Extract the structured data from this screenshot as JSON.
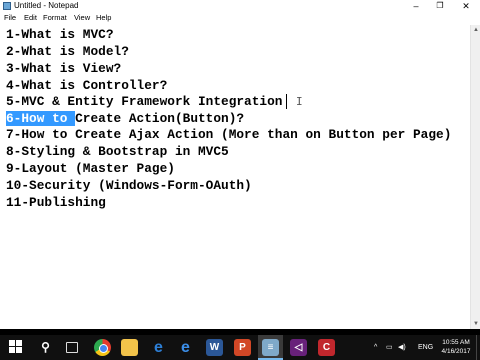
{
  "window": {
    "title": "Untitled - Notepad",
    "controls": {
      "minimize": "–",
      "maximize": "❐",
      "close": "✕"
    }
  },
  "menu": [
    "File",
    "Edit",
    "Format",
    "View",
    "Help"
  ],
  "editor": {
    "lines": [
      "1-What is MVC?",
      "2-What is Model?",
      "3-What is View?",
      "4-What is Controller?",
      "5-MVC & Entity Framework Integration",
      "6-How to Create Action(Button)?",
      "7-How to Create Ajax Action (More than on Button per Page)",
      "8-Styling & Bootstrap in MVC5",
      "9-Layout (Master Page)",
      "10-Security (Windows-Form-OAuth)",
      "11-Publishing"
    ],
    "selection": {
      "line_index": 5,
      "selected_text": "6-How to ",
      "rest_text": "Create Action(Button)?"
    },
    "selection_color": "#3399ff"
  },
  "taskbar": {
    "icons": [
      "windows-start-icon",
      "search-icon",
      "task-view-icon",
      "chrome-icon",
      "file-explorer-icon",
      "edge-icon",
      "internet-explorer-icon",
      "word-icon",
      "powerpoint-icon",
      "notepad-icon",
      "visual-studio-icon",
      "app-icon"
    ],
    "tray": {
      "up_arrow": "^",
      "language": "ENG"
    },
    "clock": {
      "time": "10:55 AM",
      "date": "4/16/2017"
    }
  }
}
